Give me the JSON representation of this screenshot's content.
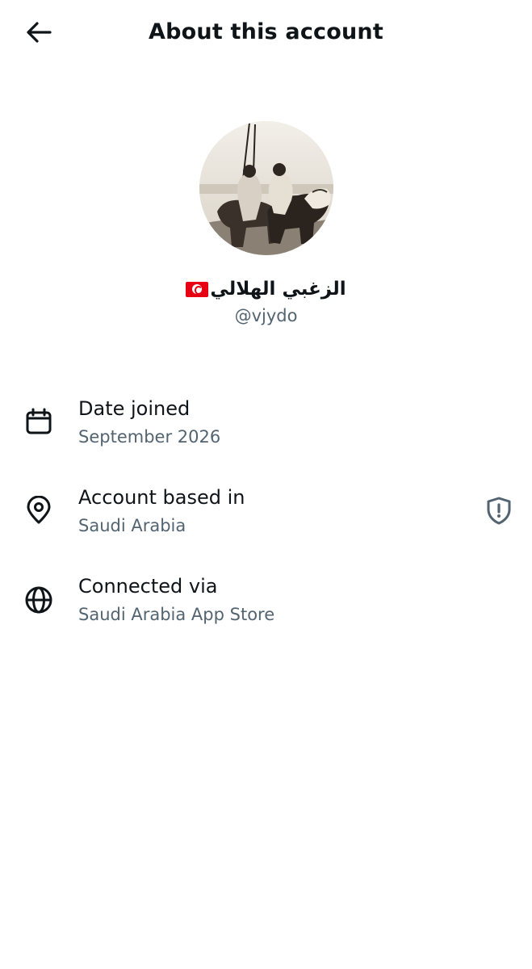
{
  "header": {
    "title": "About this account",
    "back_icon": "arrow-left-icon"
  },
  "profile": {
    "display_name": "الزغبي الهلالي",
    "flag_icon": "tunisia-flag-icon",
    "handle": "@vjydo",
    "avatar": "profile-photo"
  },
  "details": [
    {
      "label": "Date joined",
      "value": "September 2026",
      "icon": "calendar-icon"
    },
    {
      "label": "Account based in",
      "value": "Saudi Arabia",
      "icon": "location-pin-icon",
      "action_icon": "shield-alert-icon"
    },
    {
      "label": "Connected via",
      "value": "Saudi Arabia App Store",
      "icon": "globe-icon"
    }
  ],
  "colors": {
    "text_primary": "#0f1419",
    "text_secondary": "#536471"
  }
}
